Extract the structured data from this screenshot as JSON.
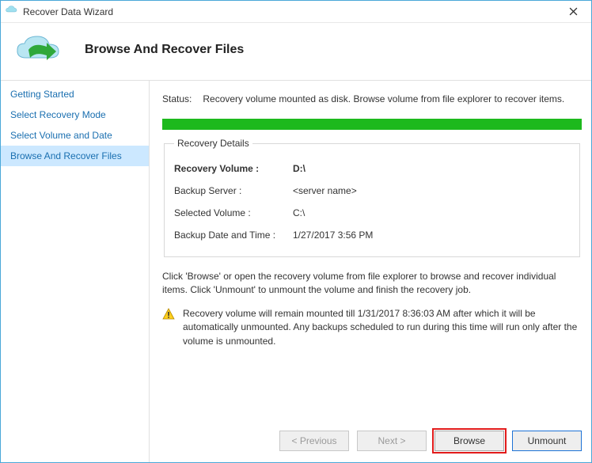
{
  "window": {
    "title": "Recover Data Wizard"
  },
  "header": {
    "title": "Browse And Recover Files"
  },
  "sidebar": {
    "items": [
      {
        "label": "Getting Started"
      },
      {
        "label": "Select Recovery Mode"
      },
      {
        "label": "Select Volume and Date"
      },
      {
        "label": "Browse And Recover Files"
      }
    ],
    "active_index": 3
  },
  "status": {
    "label": "Status:",
    "text": "Recovery volume mounted as disk. Browse volume from file explorer to recover items."
  },
  "details": {
    "legend": "Recovery Details",
    "recovery_volume_label": "Recovery Volume  :",
    "recovery_volume_value": "D:\\",
    "backup_server_label": "Backup Server :",
    "backup_server_value": "<server name>",
    "selected_volume_label": "Selected Volume :",
    "selected_volume_value": "C:\\",
    "backup_datetime_label": "Backup Date and Time :",
    "backup_datetime_value": "1/27/2017 3:56 PM"
  },
  "instruction": "Click 'Browse' or open the recovery volume from file explorer to browse and recover individual items. Click 'Unmount' to unmount the volume and finish the recovery job.",
  "warning": "Recovery volume will remain mounted till 1/31/2017 8:36:03 AM after which it will be automatically unmounted. Any backups scheduled to run during this time will run only after the volume is unmounted.",
  "buttons": {
    "previous": "< Previous",
    "next": "Next >",
    "browse": "Browse",
    "unmount": "Unmount"
  }
}
